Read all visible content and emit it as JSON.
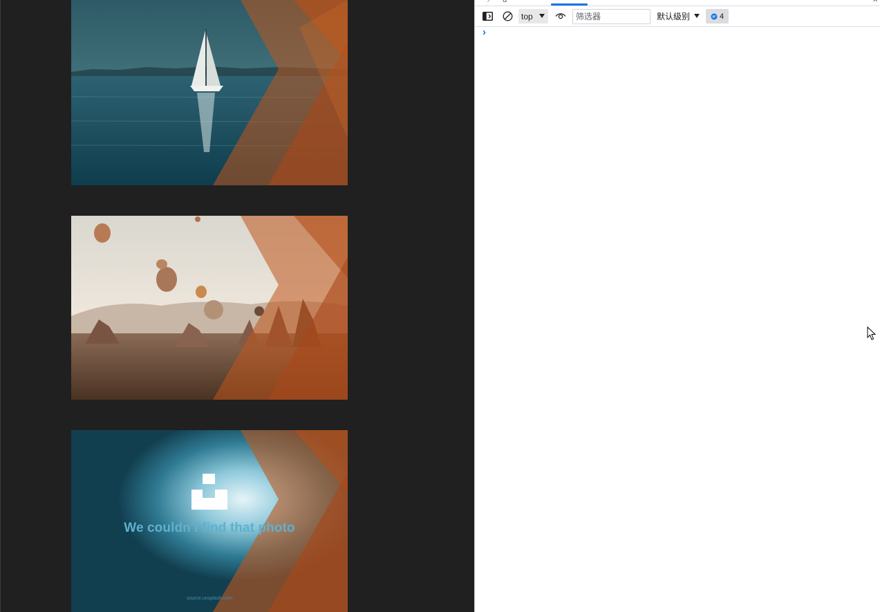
{
  "page": {
    "images": [
      {
        "name": "sailboat",
        "alt": ""
      },
      {
        "name": "hot-air-balloons",
        "alt": ""
      },
      {
        "name": "unsplash-placeholder",
        "message": "We couldn't find that photo",
        "footer": "source.unsplash.com"
      }
    ],
    "overlay_color": "#c0561c"
  },
  "devtools": {
    "toolbar": {
      "context": "top",
      "filter_placeholder": "筛选器",
      "filter_value": "",
      "levels_label": "默认级别",
      "issues_count": "4"
    },
    "console": {
      "prompt_symbol": "›"
    },
    "colors": {
      "accent": "#1a73e8",
      "toolbar_border": "#dadce0"
    }
  }
}
